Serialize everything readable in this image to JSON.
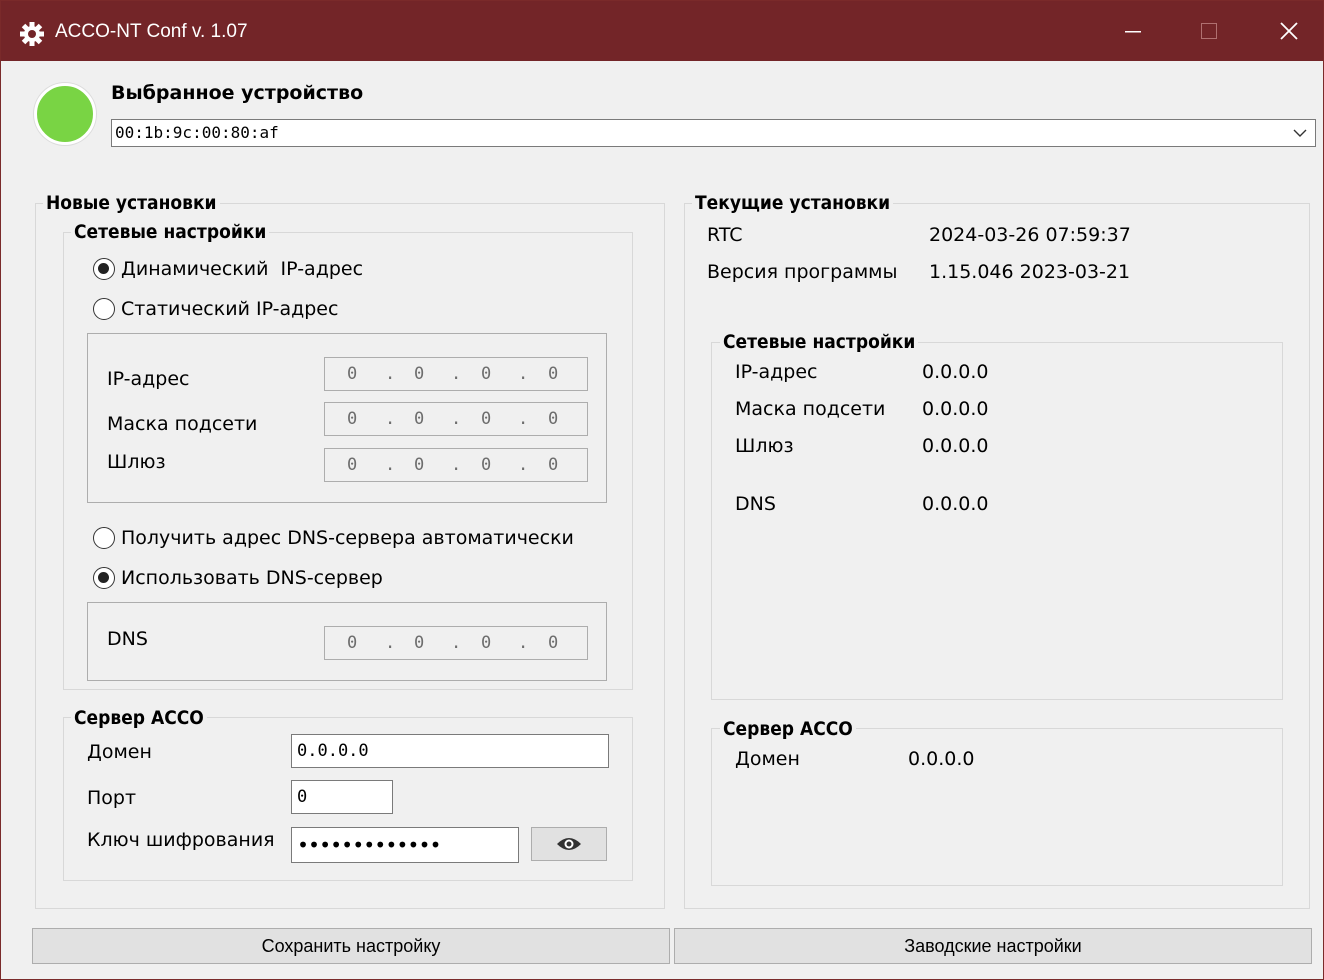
{
  "window": {
    "title": "ACCO-NT Conf v. 1.07",
    "icon": "gear-icon",
    "controls": {
      "minimize": "minimize-icon",
      "maximize": "maximize-icon",
      "close": "close-icon"
    }
  },
  "device": {
    "status_color": "#79d444",
    "label": "Выбранное устройство",
    "selected": "00:1b:9c:00:80:af"
  },
  "new_settings": {
    "title": "Новые установки",
    "network": {
      "title": "Сетевые настройки",
      "ip_mode": {
        "dynamic_label": "Динамический  IP-адрес",
        "static_label": "Статический IP-адрес",
        "selected": "dynamic"
      },
      "fields": {
        "ip_label": "IP-адрес",
        "ip_value": [
          "0",
          "0",
          "0",
          "0"
        ],
        "mask_label": "Маска подсети",
        "mask_value": [
          "0",
          "0",
          "0",
          "0"
        ],
        "gateway_label": "Шлюз",
        "gateway_value": [
          "0",
          "0",
          "0",
          "0"
        ]
      },
      "dns_mode": {
        "auto_label": "Получить адрес DNS-сервера автоматически",
        "manual_label": "Использовать DNS-сервер",
        "selected": "manual"
      },
      "dns": {
        "label": "DNS",
        "value": [
          "0",
          "0",
          "0",
          "0"
        ]
      }
    },
    "server": {
      "title": "Сервер ACCO",
      "domain_label": "Домен",
      "domain_value": "0.0.0.0",
      "port_label": "Порт",
      "port_value": "0",
      "key_label": "Ключ шифрования",
      "key_value": "•••••••••••••",
      "show_key_icon": "eye-icon"
    }
  },
  "current_settings": {
    "title": "Текущие установки",
    "rtc_label": "RTC",
    "rtc_value": "2024-03-26 07:59:37",
    "version_label": "Версия программы",
    "version_value": "1.15.046 2023-03-21",
    "network": {
      "title": "Сетевые настройки",
      "ip_label": "IP-адрес",
      "ip_value": "0.0.0.0",
      "mask_label": "Маска подсети",
      "mask_value": "0.0.0.0",
      "gateway_label": "Шлюз",
      "gateway_value": "0.0.0.0",
      "dns_label": "DNS",
      "dns_value": "0.0.0.0"
    },
    "server": {
      "title": "Сервер ACCO",
      "domain_label": "Домен",
      "domain_value": "0.0.0.0"
    }
  },
  "buttons": {
    "save_label": "Сохранить настройку",
    "factory_label": "Заводские настройки"
  }
}
